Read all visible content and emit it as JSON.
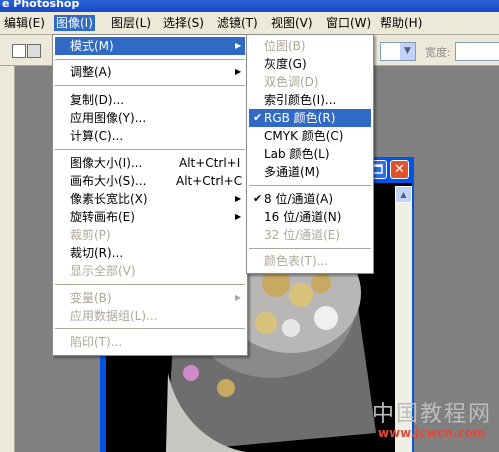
{
  "window": {
    "title": "e Photoshop"
  },
  "menubar": {
    "items": [
      {
        "label": "编辑(E)"
      },
      {
        "label": "图像(I)",
        "active": true
      },
      {
        "label": "图层(L)"
      },
      {
        "label": "选择(S)"
      },
      {
        "label": "滤镜(T)"
      },
      {
        "label": "视图(V)"
      },
      {
        "label": "窗口(W)"
      },
      {
        "label": "帮助(H)"
      }
    ]
  },
  "options_bar": {
    "width_label": "宽度:"
  },
  "image_menu": {
    "items": [
      {
        "label": "模式(M)",
        "submenu": true,
        "highlighted": true
      },
      {
        "label": "调整(A)",
        "submenu": true
      },
      {
        "label": "复制(D)..."
      },
      {
        "label": "应用图像(Y)..."
      },
      {
        "label": "计算(C)..."
      },
      {
        "label": "图像大小(I)...",
        "shortcut": "Alt+Ctrl+I"
      },
      {
        "label": "画布大小(S)...",
        "shortcut": "Alt+Ctrl+C"
      },
      {
        "label": "像素长宽比(X)",
        "submenu": true
      },
      {
        "label": "旋转画布(E)",
        "submenu": true
      },
      {
        "label": "裁剪(P)",
        "disabled": true
      },
      {
        "label": "裁切(R)..."
      },
      {
        "label": "显示全部(V)",
        "disabled": true
      },
      {
        "label": "变量(B)",
        "submenu": true,
        "disabled": true
      },
      {
        "label": "应用数据组(L)...",
        "disabled": true
      },
      {
        "label": "陷印(T)...",
        "disabled": true
      }
    ]
  },
  "mode_submenu": {
    "items": [
      {
        "label": "位图(B)",
        "disabled": true
      },
      {
        "label": "灰度(G)"
      },
      {
        "label": "双色调(D)",
        "disabled": true
      },
      {
        "label": "索引颜色(I)..."
      },
      {
        "label": "RGB 颜色(R)",
        "checked": true,
        "highlighted": true
      },
      {
        "label": "CMYK 颜色(C)"
      },
      {
        "label": "Lab 颜色(L)"
      },
      {
        "label": "多通道(M)"
      },
      {
        "label": "8 位/通道(A)",
        "checked": true
      },
      {
        "label": "16 位/通道(N)"
      },
      {
        "label": "32 位/通道(E)",
        "disabled": true
      },
      {
        "label": "颜色表(T)...",
        "disabled": true
      }
    ]
  },
  "watermark": {
    "main": "中国教程网",
    "sub": "www.jcwcn.com"
  },
  "colors": {
    "menu_highlight": "#316ac5",
    "menu_disabled": "#aca899",
    "xp_blue": "#0054e3"
  },
  "icons": {
    "submenu": "triangle-right",
    "check": "check-mark",
    "close": "close-x"
  }
}
